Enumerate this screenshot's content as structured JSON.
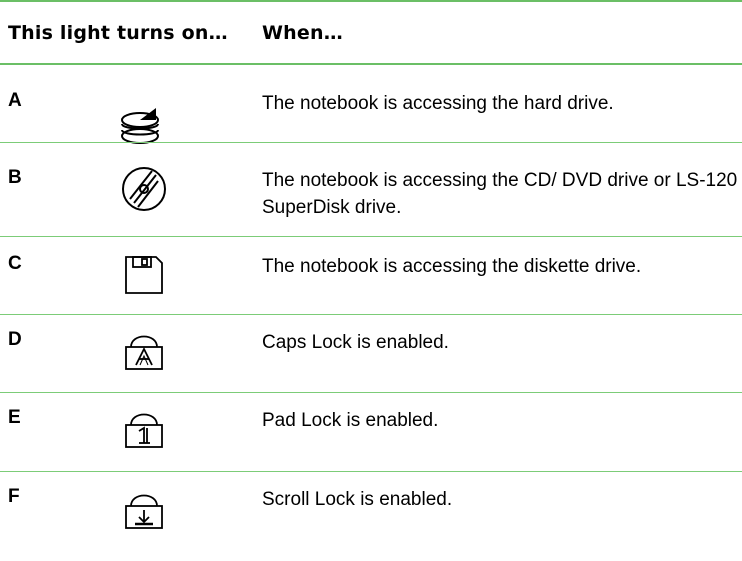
{
  "header": {
    "col1": "This light turns on…",
    "col2": "When…"
  },
  "rows": [
    {
      "letter": "A",
      "icon": "hard-drive-icon",
      "when": "The notebook is accessing the hard drive."
    },
    {
      "letter": "B",
      "icon": "cd-dvd-icon",
      "when": "The notebook is accessing the CD/ DVD drive or LS-120 SuperDisk drive."
    },
    {
      "letter": "C",
      "icon": "diskette-icon",
      "when": "The notebook is accessing the diskette drive."
    },
    {
      "letter": "D",
      "icon": "caps-lock-icon",
      "when": "Caps Lock is enabled."
    },
    {
      "letter": "E",
      "icon": "pad-lock-icon",
      "when": "Pad Lock is enabled."
    },
    {
      "letter": "F",
      "icon": "scroll-lock-icon",
      "when": "Scroll Lock is enabled."
    }
  ],
  "colors": {
    "rule": "#6bbf66"
  }
}
